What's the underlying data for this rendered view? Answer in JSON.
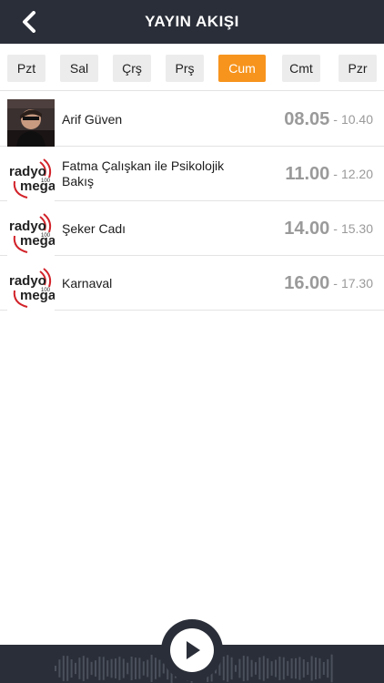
{
  "header": {
    "title": "YAYIN AKIŞI",
    "back_icon": "chevron-left-icon"
  },
  "days": [
    {
      "label": "Pzt",
      "active": false
    },
    {
      "label": "Sal",
      "active": false
    },
    {
      "label": "Çrş",
      "active": false
    },
    {
      "label": "Prş",
      "active": false
    },
    {
      "label": "Cum",
      "active": true
    },
    {
      "label": "Cmt",
      "active": false
    },
    {
      "label": "Pzr",
      "active": false
    }
  ],
  "programs": [
    {
      "title": "Arif Güven",
      "start": "08.05",
      "separator": "-",
      "end": "10.40",
      "thumb": "host-photo"
    },
    {
      "title": "Fatma Çalışkan ile Psikolojik Bakış",
      "start": "11.00",
      "separator": "-",
      "end": "12.20",
      "thumb": "radyo-mega-logo"
    },
    {
      "title": "Şeker Cadı",
      "start": "14.00",
      "separator": "-",
      "end": "15.30",
      "thumb": "radyo-mega-logo"
    },
    {
      "title": "Karnaval",
      "start": "16.00",
      "separator": "-",
      "end": "17.30",
      "thumb": "radyo-mega-logo"
    }
  ],
  "logo_text": {
    "line1": "radyo",
    "line2": "mega",
    "freq": "100"
  },
  "player": {
    "play_icon": "play-icon",
    "waveform_icon": "waveform-icon"
  },
  "colors": {
    "header_bg": "#2a2e38",
    "active_day": "#f7941d",
    "day_bg": "#ececec",
    "time_text": "#9a9a9a"
  }
}
